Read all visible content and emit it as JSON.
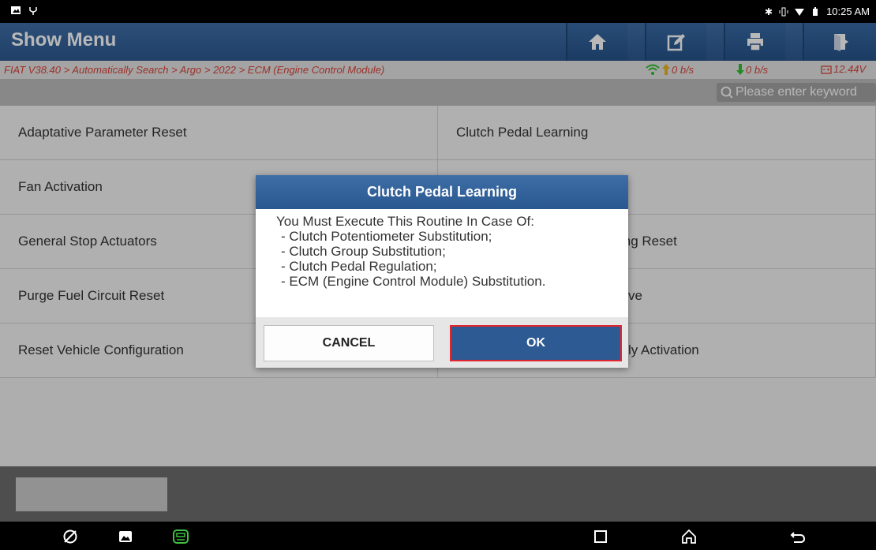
{
  "status_bar": {
    "time": "10:25 AM"
  },
  "header": {
    "title": "Show Menu",
    "buttons": [
      "home-icon",
      "edit-icon",
      "print-icon",
      "exit-icon"
    ]
  },
  "breadcrumb": {
    "path": "FIAT V38.40 > Automatically Search > Argo > 2022 > ECM (Engine Control Module)",
    "upload": "0 b/s",
    "download": "0 b/s",
    "voltage": "12.44V"
  },
  "search": {
    "placeholder": "Please enter keyword"
  },
  "menu": {
    "left": [
      "Adaptative Parameter Reset",
      "Fan Activation",
      "General Stop Actuators",
      "Purge Fuel Circuit Reset",
      "Reset Vehicle Configuration"
    ],
    "right": [
      "Clutch Pedal Learning",
      "",
      "ing Reset",
      "ve",
      "ly Activation"
    ]
  },
  "dialog": {
    "title": "Clutch Pedal Learning",
    "lines": [
      "You Must Execute This Routine In Case Of:",
      " - Clutch Potentiometer Substitution;",
      " - Clutch Group Substitution;",
      " - Clutch Pedal Regulation;",
      " - ECM (Engine Control Module) Substitution."
    ],
    "cancel_label": "CANCEL",
    "ok_label": "OK"
  },
  "colors": {
    "header_blue": "#2c5890",
    "breadcrumb_red": "#d9443a",
    "ok_border": "#e0262e",
    "vci_green": "#3fbf3f"
  }
}
